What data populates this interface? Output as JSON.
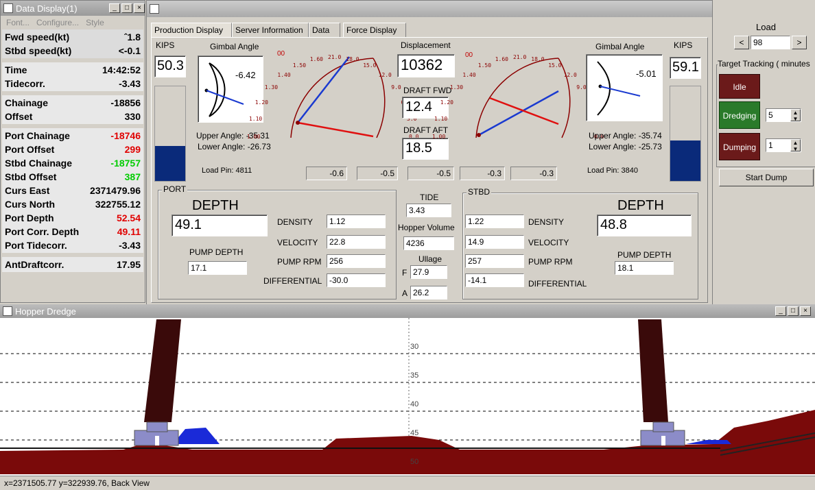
{
  "data_display": {
    "title": "Data Display(1)",
    "menu": [
      "Font...",
      "Configure...",
      "Style"
    ],
    "rows": [
      {
        "label": "Fwd speed(kt)",
        "value": "ˆ1.8",
        "color": "#000000"
      },
      {
        "label": "Stbd speed(kt)",
        "value": "<-0.1",
        "color": "#000000"
      },
      {
        "label": "Time",
        "value": "14:42:52",
        "color": "#000000"
      },
      {
        "label": "Tidecorr.",
        "value": "-3.43",
        "color": "#000000"
      },
      {
        "label": "Chainage",
        "value": "-18856",
        "color": "#000000"
      },
      {
        "label": "Offset",
        "value": "330",
        "color": "#000000"
      },
      {
        "label": "Port Chainage",
        "value": "-18746",
        "color": "#e00000"
      },
      {
        "label": "Port Offset",
        "value": "299",
        "color": "#e00000"
      },
      {
        "label": "Stbd Chainage",
        "value": "-18757",
        "color": "#00cc00"
      },
      {
        "label": "Stbd Offset",
        "value": "387",
        "color": "#00cc00"
      },
      {
        "label": "Curs East",
        "value": "2371479.96",
        "color": "#000000"
      },
      {
        "label": "Curs North",
        "value": "322755.12",
        "color": "#000000"
      },
      {
        "label": "Port Depth",
        "value": "52.54",
        "color": "#e00000"
      },
      {
        "label": "Port Corr. Depth",
        "value": "49.11",
        "color": "#e00000"
      },
      {
        "label": "Port Tidecorr.",
        "value": "-3.43",
        "color": "#000000"
      },
      {
        "label": "AntDraftcorr.",
        "value": "17.95",
        "color": "#000000"
      }
    ]
  },
  "production": {
    "tabs": [
      "Production Display",
      "Server Information",
      "Data",
      "Force Display"
    ],
    "port_kips_label": "KIPS",
    "port_kips": "50.3",
    "port_kips_fill": 0.37,
    "stbd_kips_label": "KIPS",
    "stbd_kips": "59.1",
    "stbd_kips_fill": 0.43,
    "port_gimbal_label": "Gimbal Angle",
    "port_gimbal_value": "-6.42",
    "stbd_gimbal_label": "Gimbal Angle",
    "stbd_gimbal_value": "-5.01",
    "port_upper": "Upper Angle: -35.31",
    "port_lower": "Lower Angle: -26.73",
    "stbd_upper": "Upper Angle: -35.74",
    "stbd_lower": "Lower Angle: -25.73",
    "port_loadpin": "Load Pin: 4811",
    "stbd_loadpin": "Load Pin: 3840",
    "dial_marker": "00",
    "dial_ticks": [
      "1.00",
      "1.10",
      "1.20",
      "1.30",
      "1.40",
      "1.50",
      "1.60",
      "21.0",
      "18.0",
      "15.0",
      "12.0",
      "9.0",
      "6.0",
      "3.0",
      "0.0"
    ],
    "displacement_label": "Displacement",
    "displacement": "10362",
    "draft_fwd_label": "DRAFT FWD",
    "draft_fwd": "12.4",
    "draft_aft_label": "DRAFT AFT",
    "draft_aft": "18.5",
    "tickets": [
      "-0.6",
      "-0.5",
      "-0.5",
      "-0.3",
      "-0.3"
    ],
    "port": {
      "group": "PORT",
      "depth_title": "DEPTH",
      "depth": "49.1",
      "density_label": "DENSITY",
      "density": "1.12",
      "velocity_label": "VELOCITY",
      "velocity": "22.8",
      "pump_rpm_label": "PUMP RPM",
      "pump_rpm": "256",
      "diff_label": "DIFFERENTIAL",
      "diff": "-30.0",
      "pump_depth_label": "PUMP DEPTH",
      "pump_depth": "17.1"
    },
    "stbd": {
      "group": "STBD",
      "depth_title": "DEPTH",
      "depth": "48.8",
      "density_label": "DENSITY",
      "density": "1.22",
      "velocity_label": "VELOCITY",
      "velocity": "14.9",
      "pump_rpm_label": "PUMP RPM",
      "pump_rpm": "257",
      "diff_label": "DIFFERENTIAL",
      "diff": "-14.1",
      "pump_depth_label": "PUMP DEPTH",
      "pump_depth": "18.1"
    },
    "tide_label": "TIDE",
    "tide": "3.43",
    "hopper_label": "Hopper Volume",
    "hopper": "4236",
    "ullage_label": "Ullage",
    "ullage_f_label": "F",
    "ullage_f": "27.9",
    "ullage_a_label": "A",
    "ullage_a": "26.2"
  },
  "load_panel": {
    "title": "Load",
    "prev": "<",
    "next": ">",
    "value": "98",
    "tracking_label": "Target Tracking ( minutes",
    "idle": "Idle",
    "dredging": "Dredging",
    "dredging_value": "5",
    "dumping": "Dumping",
    "dumping_value": "1",
    "start_dump": "Start Dump"
  },
  "hopper_view": {
    "title": "Hopper Dredge",
    "depth_ticks": [
      "30",
      "35",
      "40",
      "45",
      "50"
    ],
    "status": "x=2371505.77 y=322939.76, Back View"
  }
}
